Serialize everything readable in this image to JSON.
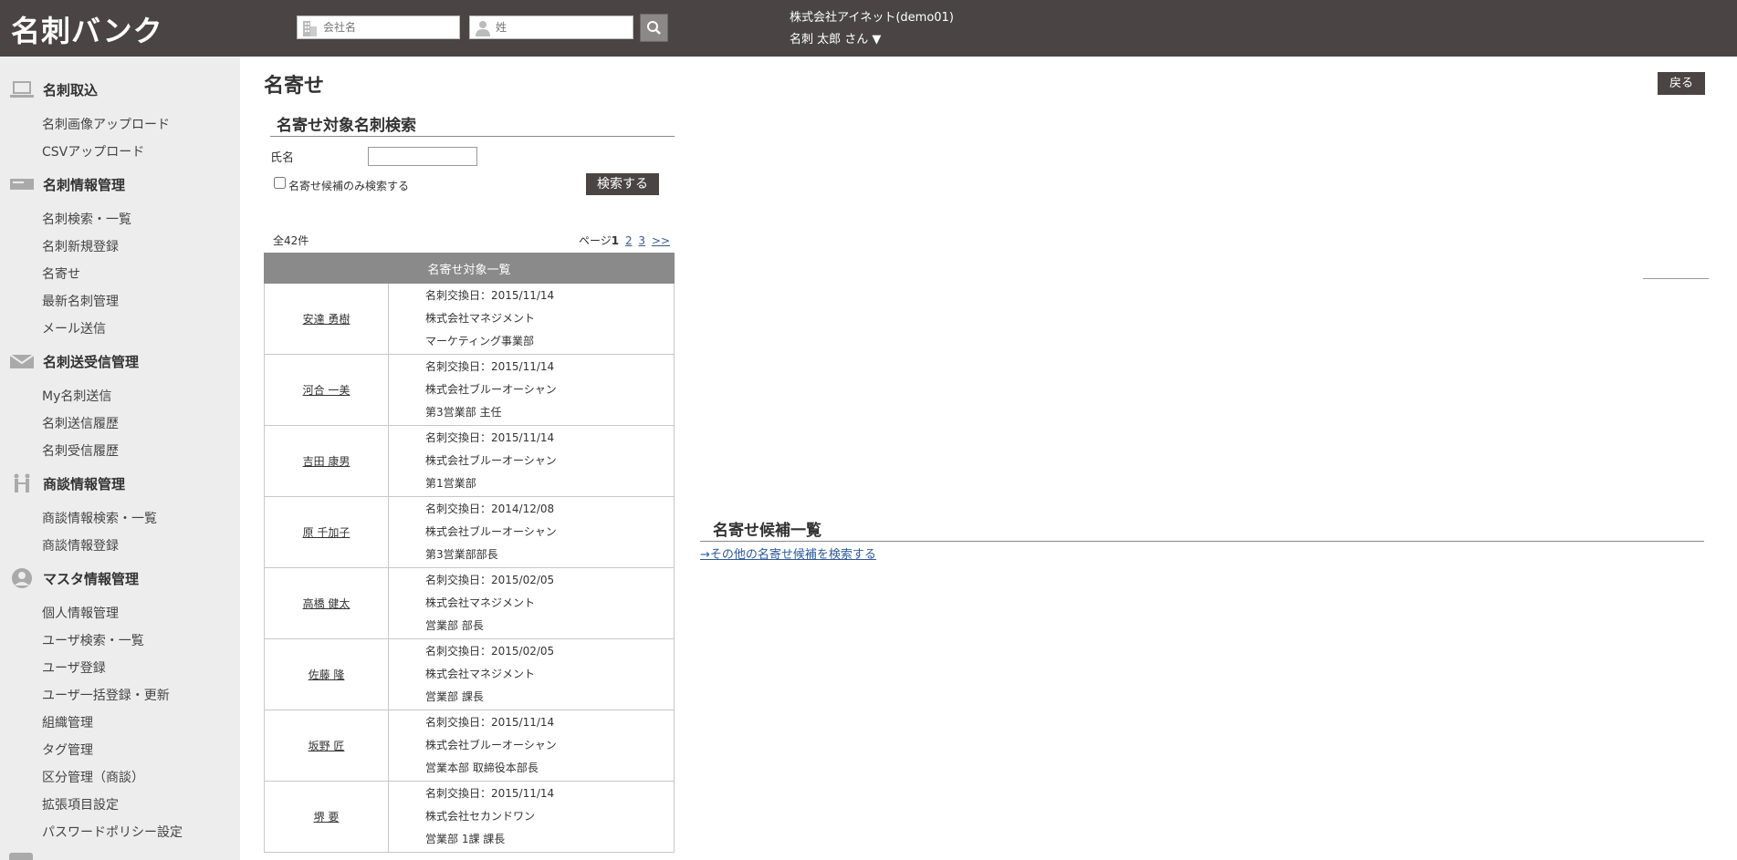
{
  "header": {
    "logo": "名刺バンク",
    "company_placeholder": "会社名",
    "surname_placeholder": "姓",
    "company_name": "株式会社アイネット(demo01)",
    "user_line": "名刺 太郎 さん ▼"
  },
  "sidebar": {
    "sections": [
      {
        "title": "名刺取込",
        "icon": "laptop-icon",
        "items": [
          "名刺画像アップロード",
          "CSVアップロード"
        ]
      },
      {
        "title": "名刺情報管理",
        "icon": "card-icon",
        "items": [
          "名刺検索・一覧",
          "名刺新規登録",
          "名寄せ",
          "最新名刺管理",
          "メール送信"
        ]
      },
      {
        "title": "名刺送受信管理",
        "icon": "envelope-icon",
        "items": [
          "My名刺送信",
          "名刺送信履歴",
          "名刺受信履歴"
        ]
      },
      {
        "title": "商談情報管理",
        "icon": "people-icon",
        "items": [
          "商談情報検索・一覧",
          "商談情報登録"
        ]
      },
      {
        "title": "マスタ情報管理",
        "icon": "user-icon",
        "items": [
          "個人情報管理",
          "ユーザ検索・一覧",
          "ユーザ登録",
          "ユーザ一括登録・更新",
          "組織管理",
          "タグ管理",
          "区分管理（商談）",
          "拡張項目設定",
          "パスワードポリシー設定"
        ]
      }
    ]
  },
  "main": {
    "title": "名寄せ",
    "back_label": "戻る",
    "search_title": "名寄せ対象名刺検索",
    "name_label": "氏名",
    "name_value": "",
    "candidate_only_label": "名寄せ候補のみ検索する",
    "search_button": "検索する",
    "total_count": "全42件",
    "pagination": {
      "prefix": "ページ",
      "current": "1",
      "pages": [
        "2",
        "3"
      ],
      "next": ">>"
    },
    "table_header": "名寄せ対象一覧",
    "rows": [
      {
        "name": "安達 勇樹",
        "date": "名刺交換日：2015/11/14",
        "company": "株式会社マネジメント",
        "dept": "マーケティング事業部"
      },
      {
        "name": "河合 一美",
        "date": "名刺交換日：2015/11/14",
        "company": "株式会社ブルーオーシャン",
        "dept": "第3営業部 主任"
      },
      {
        "name": "吉田 康男",
        "date": "名刺交換日：2015/11/14",
        "company": "株式会社ブルーオーシャン",
        "dept": "第1営業部"
      },
      {
        "name": "原 千加子",
        "date": "名刺交換日：2014/12/08",
        "company": "株式会社ブルーオーシャン",
        "dept": "第3営業部部長"
      },
      {
        "name": "高橋 健太",
        "date": "名刺交換日：2015/02/05",
        "company": "株式会社マネジメント",
        "dept": "営業部 部長"
      },
      {
        "name": "佐藤 隆",
        "date": "名刺交換日：2015/02/05",
        "company": "株式会社マネジメント",
        "dept": "営業部 課長"
      },
      {
        "name": "坂野 匠",
        "date": "名刺交換日：2015/11/14",
        "company": "株式会社ブルーオーシャン",
        "dept": "営業本部 取締役本部長"
      },
      {
        "name": "堺 要",
        "date": "名刺交換日：2015/11/14",
        "company": "株式会社セカンドワン",
        "dept": "営業部 1課 課長"
      }
    ],
    "candidate_title": "名寄せ候補一覧",
    "candidate_link": "→その他の名寄せ候補を検索する"
  }
}
